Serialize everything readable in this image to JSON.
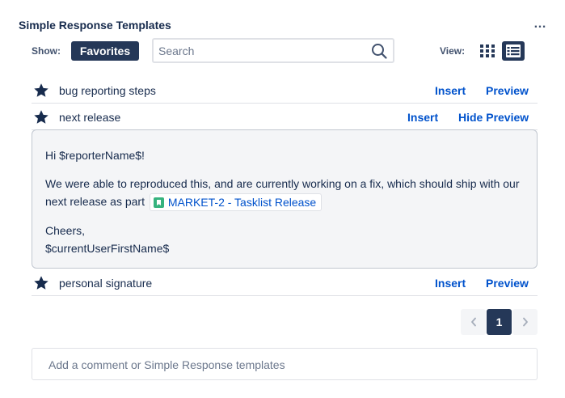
{
  "header": {
    "title": "Simple Response Templates",
    "more_label": "…"
  },
  "filter": {
    "show_label": "Show:",
    "favorites_label": "Favorites",
    "search_placeholder": "Search",
    "view_label": "View:"
  },
  "templates": [
    {
      "name": "bug reporting steps",
      "insert_label": "Insert",
      "preview_label": "Preview"
    },
    {
      "name": "next release",
      "insert_label": "Insert",
      "preview_label": "Hide Preview"
    },
    {
      "name": "personal signature",
      "insert_label": "Insert",
      "preview_label": "Preview"
    }
  ],
  "preview": {
    "greeting": "Hi $reporterName$!",
    "body": "We were able to reproduced this, and are currently working on a fix, which should ship with our next release as part",
    "issue_link": "MARKET-2 - Tasklist Release",
    "closing_line1": "Cheers,",
    "closing_line2": "$currentUserFirstName$"
  },
  "pagination": {
    "current_page": "1"
  },
  "comment": {
    "placeholder": "Add a comment or Simple Response templates"
  },
  "colors": {
    "primary_dark": "#253858",
    "link": "#0052cc",
    "story_green": "#36b37e"
  },
  "icons": [
    "more-icon",
    "search-icon",
    "grid-view-icon",
    "list-view-icon",
    "star-icon",
    "story-icon",
    "chevron-left-icon",
    "chevron-right-icon"
  ]
}
